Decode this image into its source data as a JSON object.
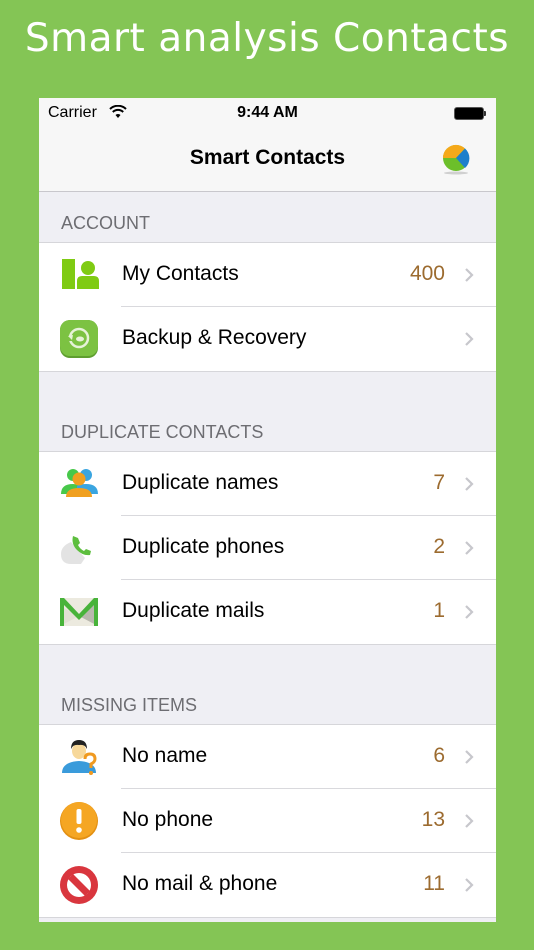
{
  "promo": {
    "title": "Smart analysis Contacts"
  },
  "status_bar": {
    "carrier": "Carrier",
    "time": "9:44 AM"
  },
  "nav": {
    "title": "Smart Contacts",
    "right_icon": "pie-chart-icon"
  },
  "colors": {
    "background": "#84C555",
    "count_text": "#9C6B2F",
    "section_text": "#6D6D72"
  },
  "sections": [
    {
      "header": "ACCOUNT",
      "rows": [
        {
          "label": "My Contacts",
          "count": "400",
          "icon": "contacts-book-icon"
        },
        {
          "label": "Backup & Recovery",
          "count": "",
          "icon": "backup-recovery-icon"
        }
      ]
    },
    {
      "header": "DUPLICATE CONTACTS",
      "rows": [
        {
          "label": "Duplicate names",
          "count": "7",
          "icon": "duplicate-users-icon"
        },
        {
          "label": "Duplicate phones",
          "count": "2",
          "icon": "phone-icon"
        },
        {
          "label": "Duplicate mails",
          "count": "1",
          "icon": "mail-icon"
        }
      ]
    },
    {
      "header": "MISSING ITEMS",
      "rows": [
        {
          "label": "No name",
          "count": "6",
          "icon": "unknown-user-icon"
        },
        {
          "label": "No phone",
          "count": "13",
          "icon": "warning-icon"
        },
        {
          "label": "No mail & phone",
          "count": "11",
          "icon": "prohibited-icon"
        }
      ]
    }
  ]
}
